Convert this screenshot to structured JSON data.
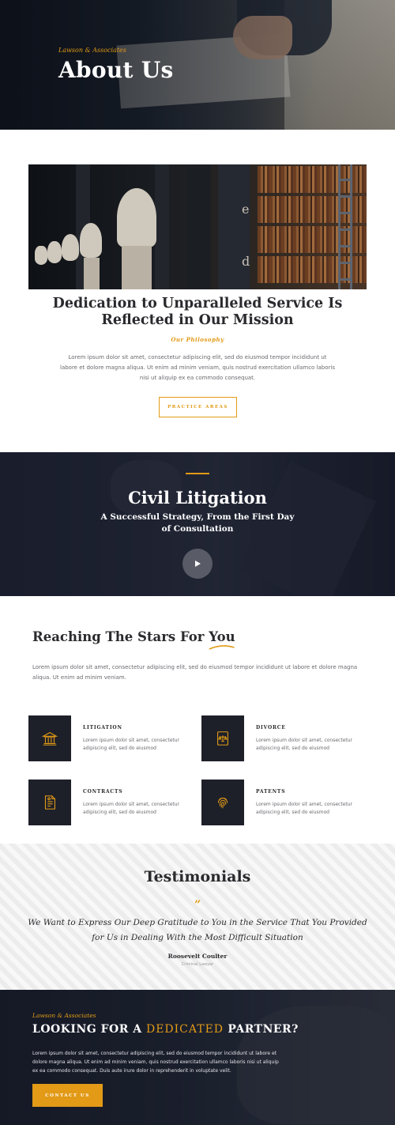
{
  "hero": {
    "kicker": "Lawson & Associates",
    "title": "About Us"
  },
  "mission": {
    "image_letters": [
      "e",
      "d"
    ],
    "title": "Dedication to Unparalleled Service Is Reflected in Our Mission",
    "kicker": "Our Philosophy",
    "body": "Lorem ipsum dolor sit amet, consectetur adipiscing elit, sed do eiusmod tempor incididunt ut labore et dolore magna aliqua. Ut enim ad minim veniam, quis nostrud exercitation ullamco laboris nisi ut aliquip ex ea commodo consequat.",
    "button_label": "PRACTICE AREAS"
  },
  "civil": {
    "title": "Civil Litigation",
    "subtitle": "A Successful Strategy, From the First Day of Consultation"
  },
  "stars": {
    "title_start": "Reaching The Stars For ",
    "title_accent": "You",
    "body": "Lorem ipsum dolor sit amet, consectetur adipiscing elit, sed do eiusmod tempor incididunt ut labore et dolore magna aliqua. Ut enim ad minim veniam."
  },
  "services": [
    {
      "name": "LITIGATION",
      "desc": "Lorem ipsum dolor sit amet, consectetur adipiscing elit, sed do eiusmod",
      "icon": "courthouse-icon"
    },
    {
      "name": "DIVORCE",
      "desc": "Lorem ipsum dolor sit amet, consectetur adipiscing elit, sed do eiusmod",
      "icon": "legal-document-scales-icon"
    },
    {
      "name": "CONTRACTS",
      "desc": "Lorem ipsum dolor sit amet, consectetur adipiscing elit, sed do eiusmod",
      "icon": "contract-icon"
    },
    {
      "name": "PATENTS",
      "desc": "Lorem ipsum dolor sit amet, consectetur adipiscing elit, sed do eiusmod",
      "icon": "fingerprint-icon"
    }
  ],
  "testimonials": {
    "title": "Testimonials",
    "quote_mark": "”",
    "quote": "We Want to Express Our Deep Gratitude to You in the Service That You Provided for Us in Dealing With the Most Difficult Situation",
    "author": "Roosevelt Coulter",
    "role": "Criminal Lawyer"
  },
  "cta": {
    "kicker": "Lawson & Associates",
    "title_start": "LOOKING FOR A ",
    "title_accent": "DEDICATED",
    "title_end": " PARTNER?",
    "body": "Lorem ipsum dolor sit amet, consectetur adipiscing elit, sed do eiusmod tempor incididunt ut labore et dolore magna aliqua. Ut enim ad minim veniam, quis nostrud exercitation ullamco laboris nisi ut aliquip ex ea commodo consequat. Duis aute irure dolor in reprehenderit in voluptate velit.",
    "button_label": "CONTACT US"
  },
  "colors": {
    "accent": "#e29a17",
    "dark": "#1e2029",
    "text": "#2a2a2e"
  }
}
